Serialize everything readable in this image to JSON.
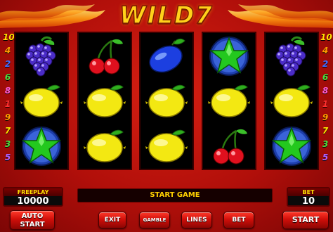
{
  "game": {
    "title": "WILD7"
  },
  "paylines": {
    "left": [
      {
        "n": "10",
        "c": "#ffe000"
      },
      {
        "n": "4",
        "c": "#ff9c00"
      },
      {
        "n": "2",
        "c": "#3f6cff"
      },
      {
        "n": "6",
        "c": "#48e040"
      },
      {
        "n": "8",
        "c": "#ff5ad2"
      },
      {
        "n": "1",
        "c": "#ff3030"
      },
      {
        "n": "9",
        "c": "#ff9c00"
      },
      {
        "n": "7",
        "c": "#ffe000"
      },
      {
        "n": "3",
        "c": "#48e040"
      },
      {
        "n": "5",
        "c": "#b060ff"
      }
    ],
    "right": [
      {
        "n": "10",
        "c": "#ffe000"
      },
      {
        "n": "4",
        "c": "#ff9c00"
      },
      {
        "n": "2",
        "c": "#3f6cff"
      },
      {
        "n": "6",
        "c": "#48e040"
      },
      {
        "n": "8",
        "c": "#ff5ad2"
      },
      {
        "n": "1",
        "c": "#ff3030"
      },
      {
        "n": "9",
        "c": "#ff9c00"
      },
      {
        "n": "7",
        "c": "#ffe000"
      },
      {
        "n": "3",
        "c": "#48e040"
      },
      {
        "n": "5",
        "c": "#b060ff"
      }
    ]
  },
  "reels": [
    [
      "grapes",
      "lemon",
      "star"
    ],
    [
      "cherries",
      "lemon",
      "lemon"
    ],
    [
      "plum",
      "lemon",
      "lemon"
    ],
    [
      "star",
      "lemon",
      "cherries"
    ],
    [
      "grapes",
      "lemon",
      "star"
    ]
  ],
  "panel": {
    "freeplay_label": "FREEPLAY",
    "freeplay_value": "10000",
    "message": "START GAME",
    "bet_label": "BET",
    "bet_value": "10"
  },
  "buttons": {
    "autostart_line1": "AUTO",
    "autostart_line2": "START",
    "exit": "EXIT",
    "gamble": "GAMBLE",
    "lines": "LINES",
    "bet": "BET",
    "start": "START"
  },
  "colors": {
    "background": "#c4140d",
    "accent": "#ffd21a",
    "reel_bg": "#000000"
  }
}
